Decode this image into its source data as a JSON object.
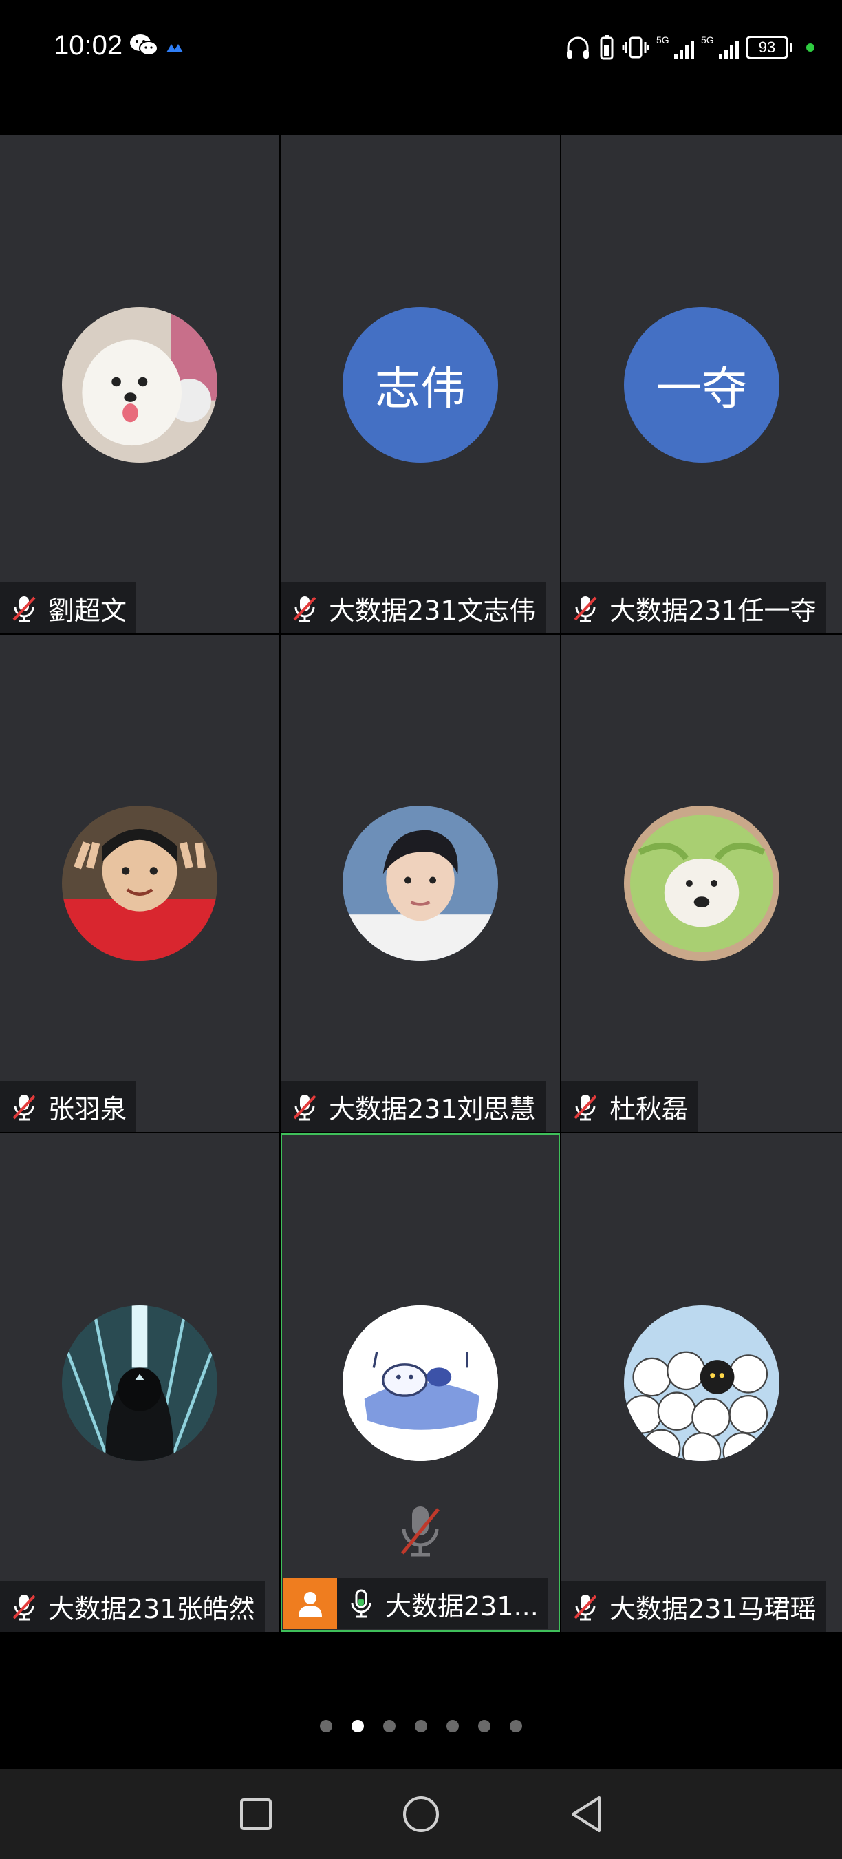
{
  "status_bar": {
    "time": "10:02",
    "battery": "93",
    "signal_labels": [
      "5G",
      "5G"
    ],
    "icons": [
      "wechat-icon",
      "app-icon",
      "headphones-icon",
      "battery-saver-icon",
      "vibrate-icon",
      "signal-icon",
      "battery-icon"
    ]
  },
  "participants": [
    {
      "name": "劉超文",
      "avatar": "white-dog-photo",
      "muted": true
    },
    {
      "name": "大数据231文志伟",
      "avatar_text": "志伟",
      "muted": true
    },
    {
      "name": "大数据231任一夺",
      "avatar_text": "一夺",
      "muted": true
    },
    {
      "name": "张羽泉",
      "avatar": "child-photo",
      "muted": true
    },
    {
      "name": "大数据231刘思慧",
      "avatar": "boy-portrait-photo",
      "muted": true
    },
    {
      "name": "杜秋磊",
      "avatar": "cabbage-dog-photo",
      "muted": true
    },
    {
      "name": "大数据231张皓然",
      "avatar": "hooded-figure-photo",
      "muted": true
    },
    {
      "name": "大数据231...",
      "avatar": "sleeping-cartoon",
      "muted": false,
      "host": true,
      "active": true
    },
    {
      "name": "大数据231马珺瑶",
      "avatar": "cat-crowd-cartoon",
      "muted": true
    }
  ],
  "pager": {
    "count": 7,
    "active_index": 1
  },
  "colors": {
    "tile": "#2e2f33",
    "initials_avatar": "#4470c4",
    "host_badge": "#ef7d1f",
    "active_border": "#3fbf5a"
  },
  "nav": {
    "icons": [
      "recents-square-icon",
      "home-circle-icon",
      "back-triangle-icon"
    ]
  }
}
